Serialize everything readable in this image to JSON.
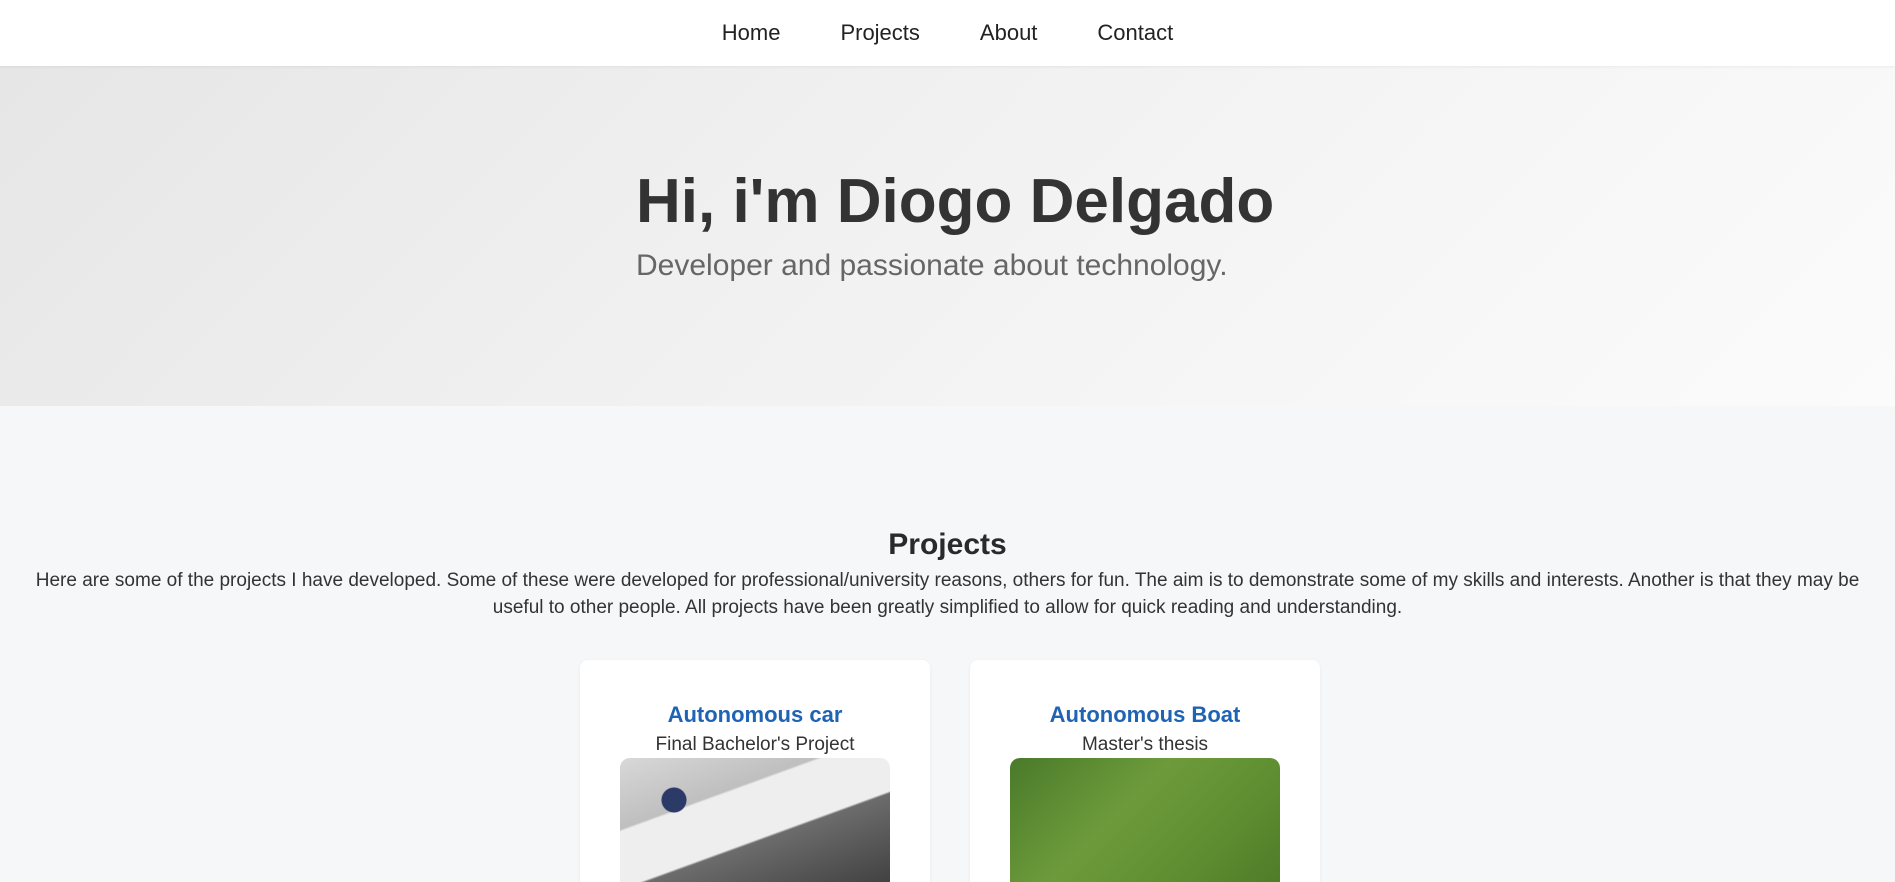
{
  "nav": {
    "items": [
      {
        "label": "Home"
      },
      {
        "label": "Projects"
      },
      {
        "label": "About"
      },
      {
        "label": "Contact"
      }
    ]
  },
  "hero": {
    "title": "Hi, i'm Diogo Delgado",
    "subtitle": "Developer and passionate about technology."
  },
  "projects": {
    "title": "Projects",
    "description": "Here are some of the projects I have developed. Some of these were developed for professional/university reasons, others for fun. The aim is to demonstrate some of my skills and interests. Another is that they may be useful to other people. All projects have been greatly simplified to allow for quick reading and understanding.",
    "cards": [
      {
        "title": "Autonomous car",
        "subtitle": "Final Bachelor's Project"
      },
      {
        "title": "Autonomous Boat",
        "subtitle": "Master's thesis"
      }
    ]
  },
  "colors": {
    "accent": "#1f63b4",
    "background": "#f6f7f9",
    "text": "#333333"
  }
}
